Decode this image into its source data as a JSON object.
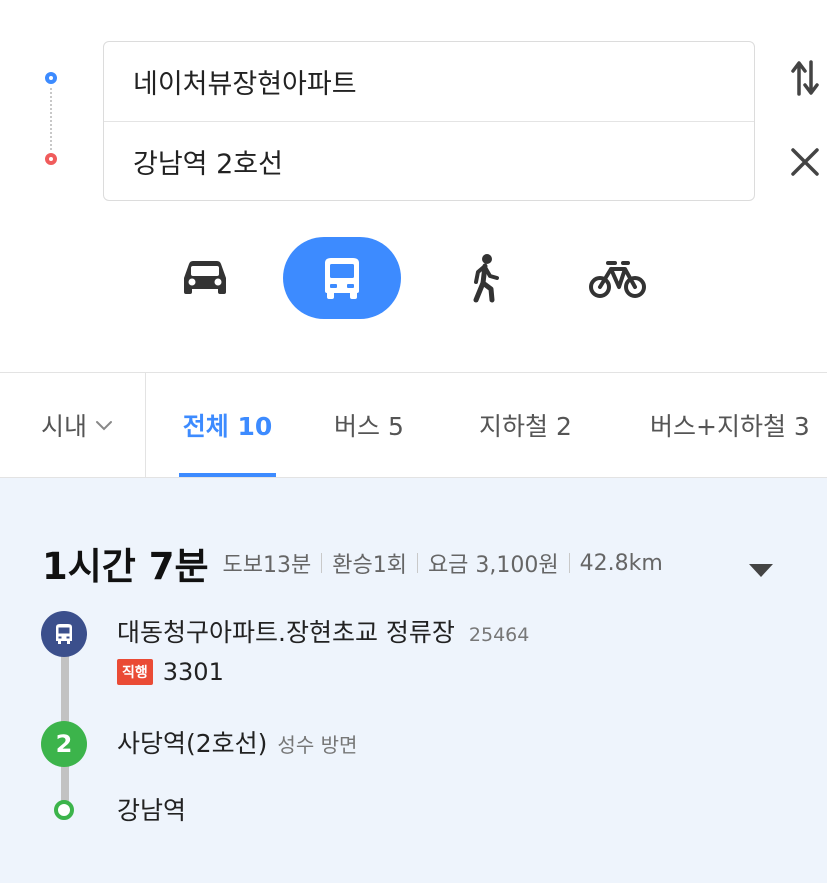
{
  "search": {
    "origin": "네이처뷰장현아파트",
    "destination": "강남역 2호선"
  },
  "modes": [
    {
      "name": "car",
      "icon": "car-icon",
      "active": false
    },
    {
      "name": "transit",
      "icon": "bus-icon",
      "active": true
    },
    {
      "name": "walk",
      "icon": "walk-icon",
      "active": false
    },
    {
      "name": "bike",
      "icon": "bicycle-icon",
      "active": false
    }
  ],
  "region_filter": "시내",
  "tabs": [
    {
      "label": "전체 10",
      "active": true
    },
    {
      "label": "버스 5",
      "active": false
    },
    {
      "label": "지하철 2",
      "active": false
    },
    {
      "label": "버스+지하철 3",
      "active": false
    }
  ],
  "result": {
    "total_time": "1시간 7분",
    "walk": "도보13분",
    "transfer": "환승1회",
    "fare": "요금 3,100원",
    "distance": "42.8km",
    "steps": [
      {
        "type": "bus",
        "stop": "대동청구아파트.장현초교 정류장",
        "stop_code": "25464",
        "badge": "직행",
        "route": "3301"
      },
      {
        "type": "subway",
        "line_label": "2",
        "stop": "사당역(2호선)",
        "direction": "성수 방면"
      },
      {
        "type": "arrival",
        "stop": "강남역"
      }
    ]
  },
  "colors": {
    "accent": "#3d8bff",
    "origin_dot": "#3d8bff",
    "destination_dot": "#f05c5c",
    "bus_marker": "#3b4f8c",
    "line2_green": "#3cb44b",
    "express_badge": "#ea4b35",
    "result_bg": "#eef4fc"
  }
}
